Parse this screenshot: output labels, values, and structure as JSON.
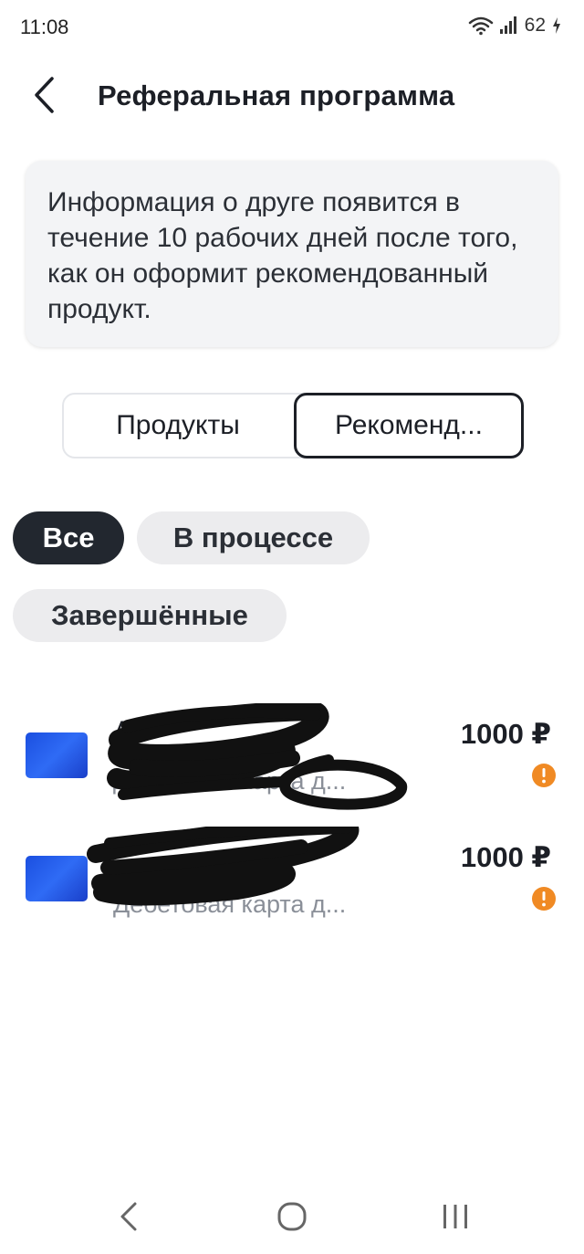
{
  "status_bar": {
    "time": "11:08",
    "battery": "62",
    "icons": [
      "wifi-icon",
      "signal-icon",
      "charging-icon"
    ]
  },
  "header": {
    "title": "Реферальная программа",
    "back_icon": "chevron-left-icon"
  },
  "info_card": {
    "text": "Информация о друге появится в течение 10 рабочих дней после того, как он оформит рекомендованный продукт."
  },
  "tabs": [
    {
      "label": "Продукты",
      "selected": false
    },
    {
      "label": "Рекоменд...",
      "selected": true
    }
  ],
  "filters": [
    {
      "label": "Все",
      "selected": true
    },
    {
      "label": "В процессе",
      "selected": false
    },
    {
      "label": "Завершённые",
      "selected": false
    }
  ],
  "referrals": [
    {
      "name": "А",
      "subtitle": "Дебетовая карта д...",
      "amount": "1000 ₽",
      "status_icon": "warning-icon",
      "status_color": "#f08a24"
    },
    {
      "name": "",
      "subtitle": "Дебетовая карта д...",
      "amount": "1000 ₽",
      "status_icon": "warning-icon",
      "status_color": "#f08a24"
    }
  ],
  "nav_bar": {
    "icons": [
      "nav-back-icon",
      "nav-home-icon",
      "nav-recents-icon"
    ]
  },
  "colors": {
    "accent_dark": "#22272f",
    "card_blue": "#1b4fe0",
    "warning": "#f08a24",
    "info_bg": "#f3f4f6"
  }
}
